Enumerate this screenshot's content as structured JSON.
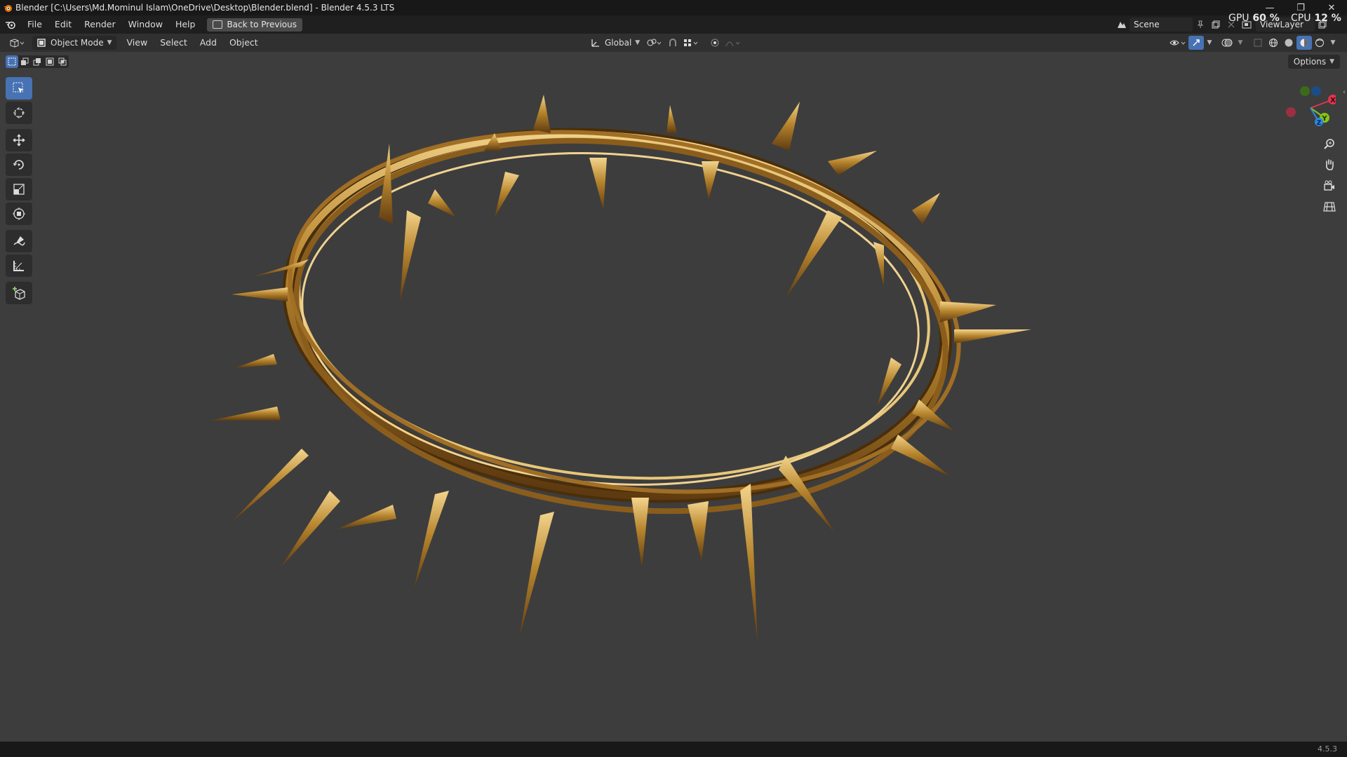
{
  "window": {
    "title": "Blender [C:\\Users\\Md.Mominul Islam\\OneDrive\\Desktop\\Blender.blend] - Blender 4.5.3 LTS",
    "minimize_glyph": "—",
    "restore_glyph": "❐",
    "close_glyph": "✕"
  },
  "stats": {
    "gpu_label": "GPU",
    "gpu_value": "60 %",
    "cpu_label": "CPU",
    "cpu_value": "12 %"
  },
  "menubar": {
    "items": [
      "File",
      "Edit",
      "Render",
      "Window",
      "Help"
    ],
    "back_label": "Back to Previous",
    "scene": "Scene",
    "view_layer": "ViewLayer"
  },
  "viewport_header": {
    "mode": "Object Mode",
    "menus": [
      "View",
      "Select",
      "Add",
      "Object"
    ],
    "orientation": "Global",
    "options_label": "Options"
  },
  "gizmo": {
    "x_label": "X",
    "y_label": "Y",
    "z_label": "Z"
  },
  "status": {
    "version": "4.5.3"
  },
  "colors": {
    "accent": "#4772b3",
    "viewport_bg": "#3d3d3d",
    "gold": "#b8862e",
    "axis_x": "#e0344f",
    "axis_y": "#84c51a",
    "axis_z": "#2f86e6"
  }
}
